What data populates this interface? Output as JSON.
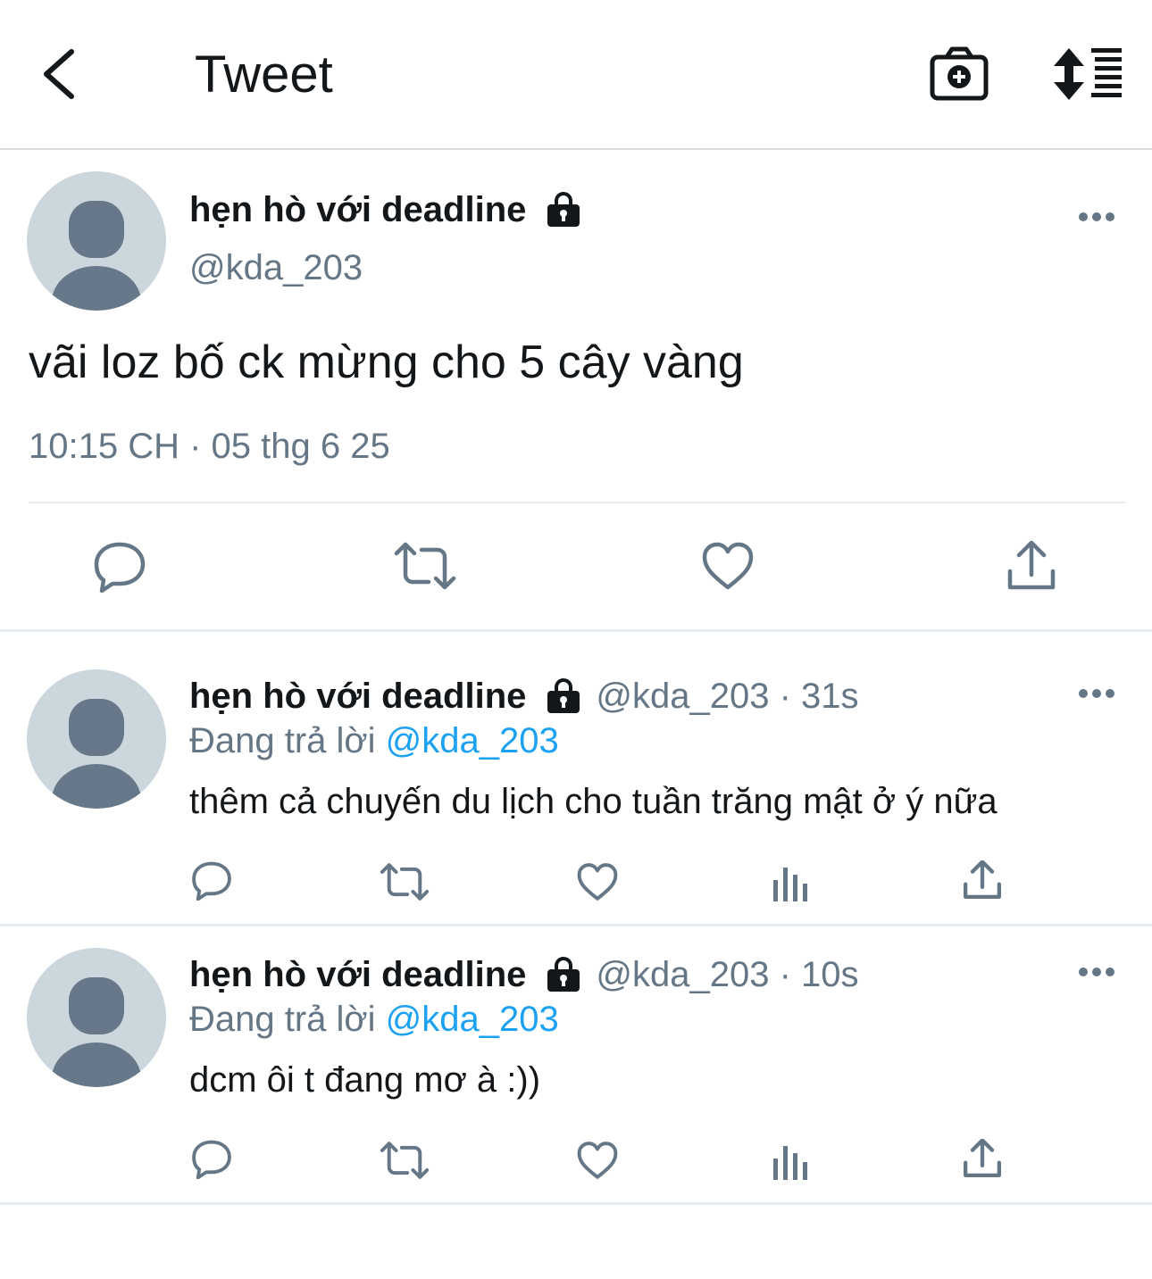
{
  "header": {
    "title": "Tweet",
    "back_icon": "chevron-left-icon",
    "camera_icon": "add-photo-camera-icon",
    "sort_icon": "sort-replies-icon"
  },
  "main_tweet": {
    "display_name": "hẹn hò với deadline",
    "handle": "@kda_203",
    "text": "vãi loz bố ck mừng cho 5 cây vàng",
    "timestamp": "10:15 CH · 05 thg 6 25",
    "actions": [
      "reply-icon",
      "retweet-icon",
      "like-icon",
      "share-icon"
    ]
  },
  "replies": [
    {
      "display_name": "hẹn hò với deadline",
      "handle_time": "@kda_203 · 31s",
      "replying_prefix": "Đang trả lời ",
      "replying_to": "@kda_203",
      "text": "thêm cả chuyến du lịch cho tuần trăng mật ở ý nữa"
    },
    {
      "display_name": "hẹn hò với deadline",
      "handle_time": "@kda_203 · 10s",
      "replying_prefix": "Đang trả lời ",
      "replying_to": "@kda_203",
      "text": "dcm ôi t đang mơ à :))"
    }
  ],
  "colors": {
    "text": "#14171a",
    "secondary": "#657786",
    "link": "#1da1f2",
    "avatar_bg": "#ccd6dd",
    "avatar_fg": "#66788a",
    "divider": "#e6ecf0"
  }
}
